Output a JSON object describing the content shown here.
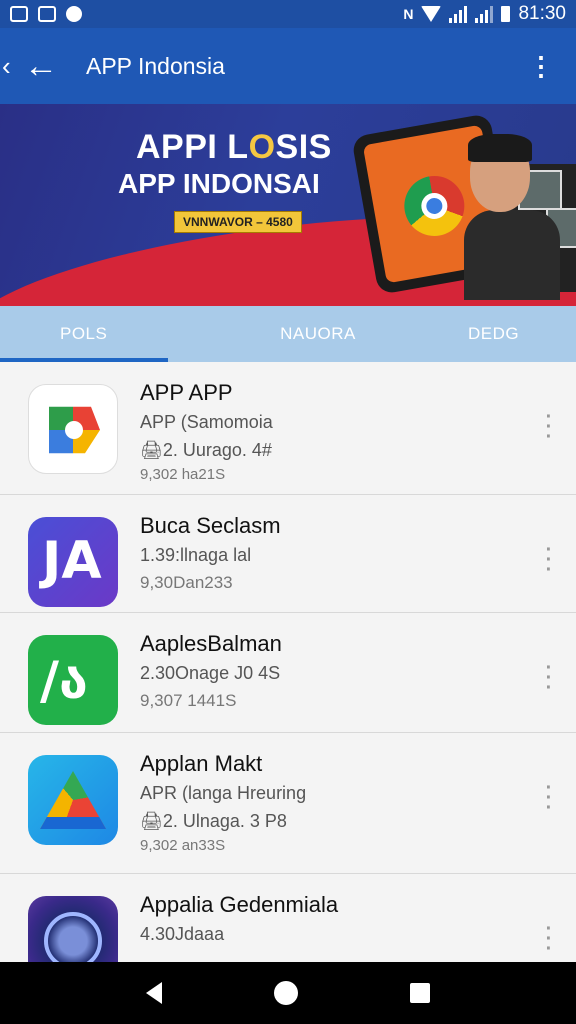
{
  "status_bar": {
    "time": "81:30"
  },
  "app_bar": {
    "title": "APP Indonsia",
    "back_chevron": "‹",
    "back_arrow": "←",
    "menu_glyph": "⋮"
  },
  "banner": {
    "title_part1": "APPI L",
    "title_accent": "O",
    "title_part2": "SIS",
    "subtitle": "APP INDONSAI",
    "tag": "VNNWAVOR – 4580",
    "carousel_dots": 5,
    "active_dot": 0
  },
  "tabs": [
    {
      "label": "POLS",
      "active": true
    },
    {
      "label": "NAUORA",
      "active": false
    },
    {
      "label": "DEDG",
      "active": false
    }
  ],
  "apps": [
    {
      "name": "APP APP",
      "line2": "APP (Samomoia",
      "line3": "🖨2. Uurago. 4#",
      "line4": "9,302 ha21S",
      "icon": "multicolor-d-icon"
    },
    {
      "name": "Buca Seclasm",
      "line2": "1.39:llnaga lal",
      "line3": "9,30Dan233",
      "line4": "",
      "icon": "purple-letter-icon",
      "glyph": "JA"
    },
    {
      "name": "AaplesBalman",
      "line2": "2.30Onage J0 4S",
      "line3": "9,307 1441S",
      "line4": "",
      "icon": "green-letter-icon",
      "glyph": "/ა"
    },
    {
      "name": "Applan Makt",
      "line2": "APR (langa Hreuring",
      "line3": "🖨2. Ulnaga. 3 P8",
      "line4": "9,302 an33S",
      "icon": "drive-triangle-icon"
    },
    {
      "name": "Appalia Gedenmiala",
      "line2": "4.30Jdaaa",
      "line3": "",
      "line4": "",
      "icon": "camera-lens-icon"
    }
  ],
  "colors": {
    "status_bar": "#1e4fa3",
    "app_bar": "#1f58b5",
    "tabs_bg": "#a9cbe9",
    "tab_indicator": "#1f66c4",
    "list_bg": "#f4f4f4"
  }
}
